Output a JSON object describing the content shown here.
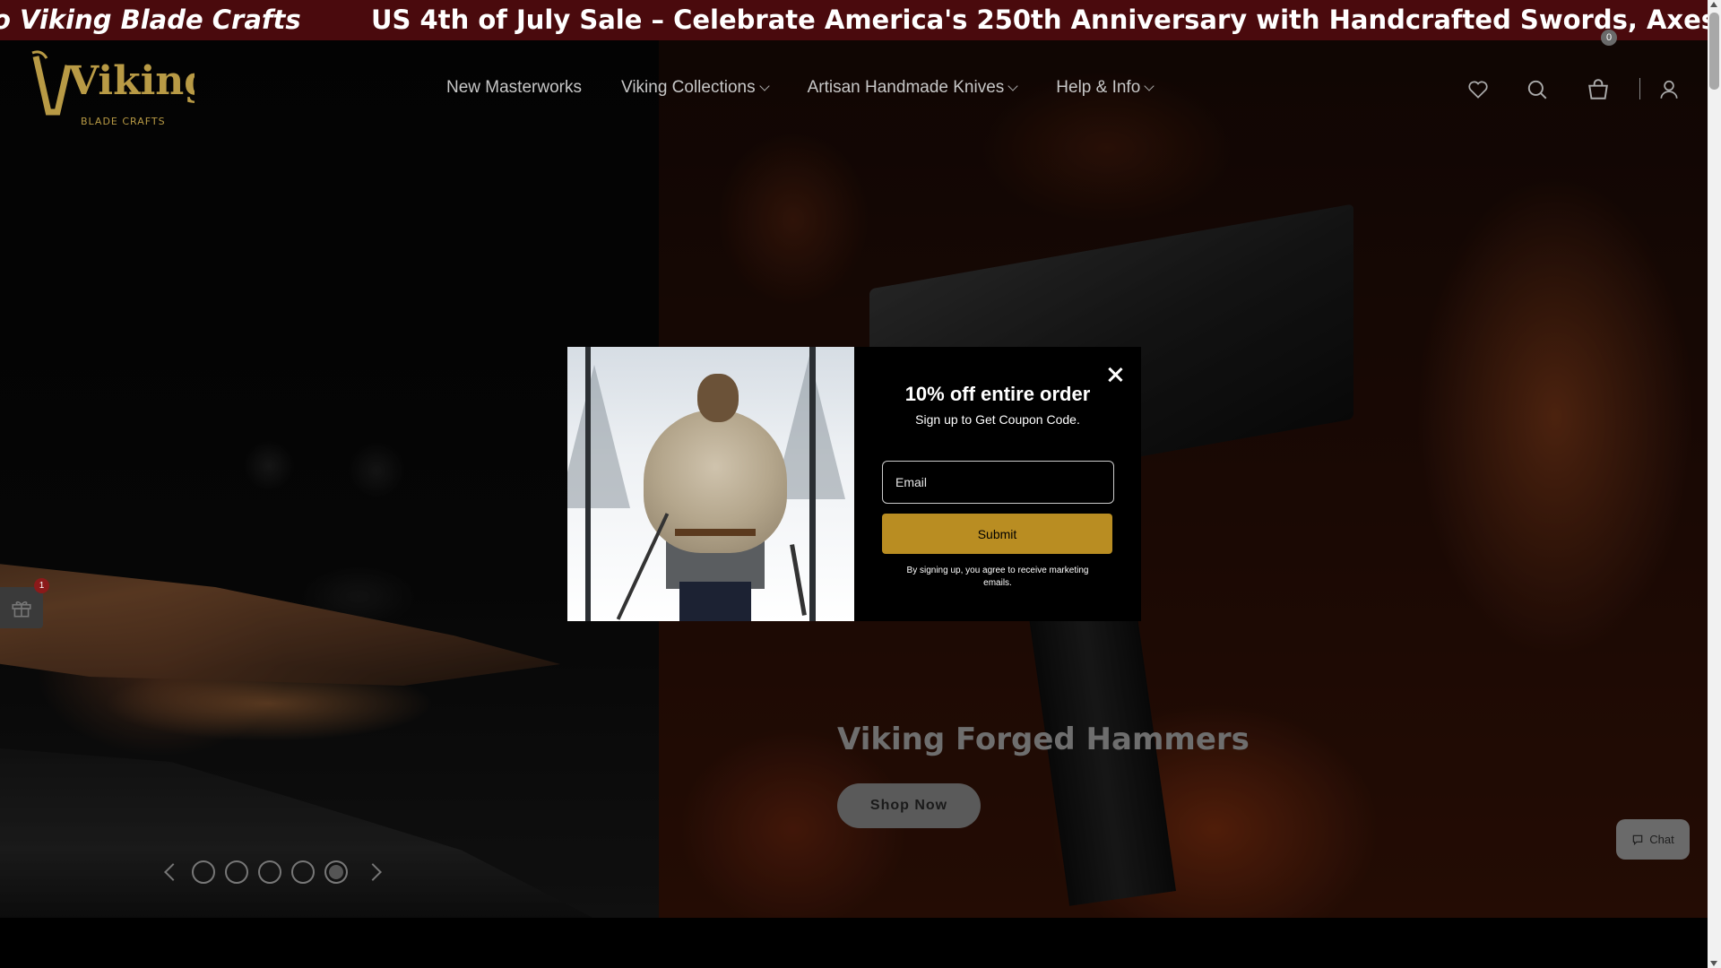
{
  "announcement": {
    "text_left": "o Viking Blade Crafts",
    "text_main": "US 4th of July Sale – Celebrate America's 250th Anniversary with Handcrafted Swords, Axes & More"
  },
  "header": {
    "logo_text": "Viking",
    "logo_subtext": "BLADE CRAFTS",
    "nav": [
      {
        "label": "New Masterworks",
        "has_dropdown": false
      },
      {
        "label": "Viking Collections",
        "has_dropdown": true
      },
      {
        "label": "Artisan Handmade Knives",
        "has_dropdown": true
      },
      {
        "label": "Help & Info",
        "has_dropdown": true
      }
    ],
    "icons": [
      "heart-icon",
      "search-icon",
      "cart-icon",
      "user-icon"
    ],
    "cart_count": "0"
  },
  "hero": {
    "heading": "Viking Forged Hammers",
    "cta_label": "Shop Now",
    "slides_count": 5,
    "active_slide": 5
  },
  "gift": {
    "badge": "1"
  },
  "chat": {
    "label": "Chat"
  },
  "popup": {
    "title": "10% off entire order",
    "subtitle": "Sign up to Get Coupon Code.",
    "email_placeholder": "Email",
    "submit_label": "Submit",
    "legal": "By signing up, you agree to receive marketing emails."
  },
  "colors": {
    "announcement_bg": "#4a0a0d",
    "accent_gold": "#b98d22",
    "logo_gold": "#b89a45"
  }
}
